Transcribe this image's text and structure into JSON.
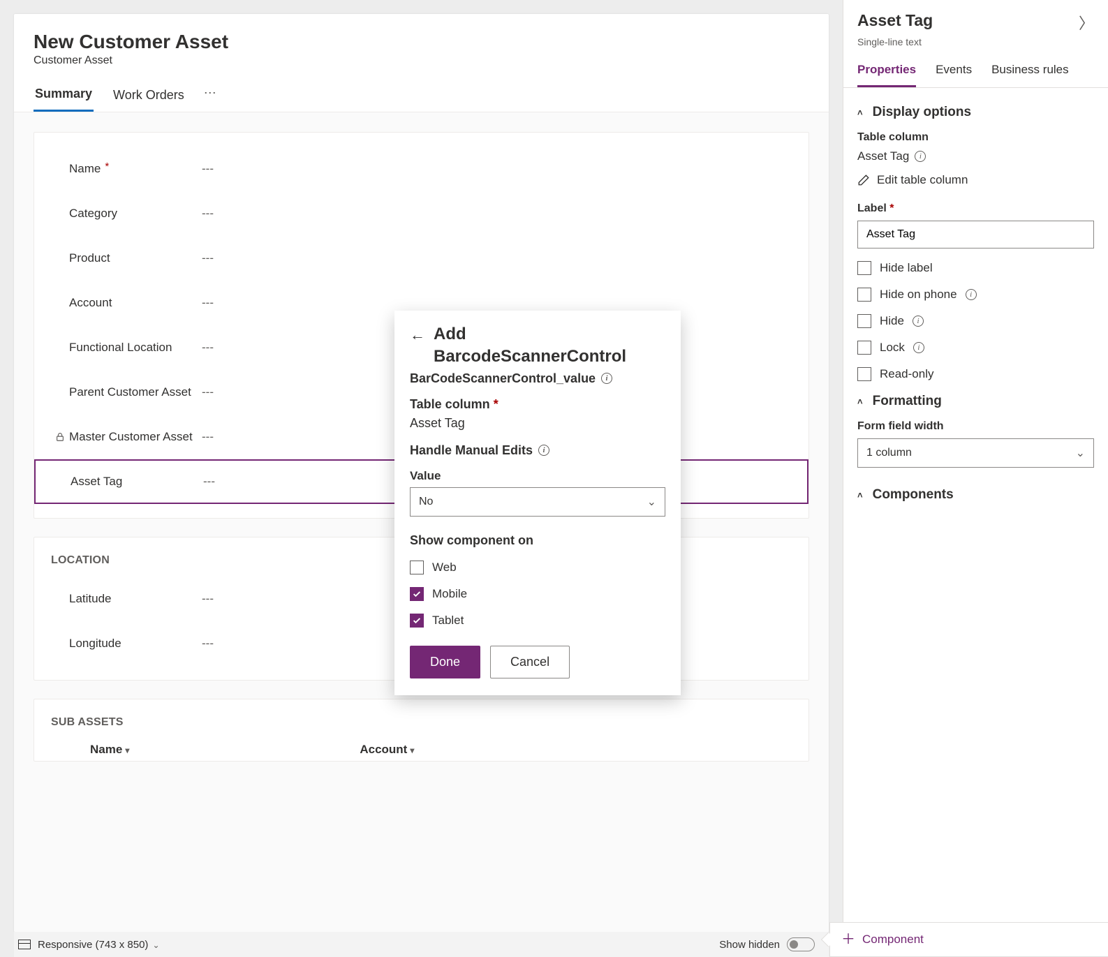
{
  "form": {
    "title": "New Customer Asset",
    "entity": "Customer Asset",
    "tabs": [
      "Summary",
      "Work Orders"
    ],
    "active_tab": "Summary",
    "general_fields": [
      {
        "label": "Name",
        "required": true,
        "locked": false,
        "value": "---"
      },
      {
        "label": "Category",
        "required": false,
        "locked": false,
        "value": "---"
      },
      {
        "label": "Product",
        "required": false,
        "locked": false,
        "value": "---"
      },
      {
        "label": "Account",
        "required": false,
        "locked": false,
        "value": "---"
      },
      {
        "label": "Functional Location",
        "required": false,
        "locked": false,
        "value": "---"
      },
      {
        "label": "Parent Customer Asset",
        "required": false,
        "locked": false,
        "value": "---"
      },
      {
        "label": "Master Customer Asset",
        "required": false,
        "locked": true,
        "value": "---"
      },
      {
        "label": "Asset Tag",
        "required": false,
        "locked": false,
        "value": "---",
        "selected": true
      }
    ],
    "location_section": {
      "title": "LOCATION",
      "fields": [
        {
          "label": "Latitude",
          "value": "---"
        },
        {
          "label": "Longitude",
          "value": "---"
        }
      ]
    },
    "subassets_section": {
      "title": "SUB ASSETS",
      "columns": [
        "Name",
        "Account"
      ]
    }
  },
  "statusbar": {
    "mode_label": "Responsive (743 x 850)",
    "show_hidden_label": "Show hidden"
  },
  "popup": {
    "title_line1": "Add",
    "title_line2": "BarcodeScannerControl",
    "subtitle": "BarCodeScannerControl_value",
    "table_column_label": "Table column",
    "table_column_value": "Asset Tag",
    "manual_edits_label": "Handle Manual Edits",
    "value_label": "Value",
    "value_selected": "No",
    "show_on_label": "Show component on",
    "platforms": [
      {
        "label": "Web",
        "checked": false
      },
      {
        "label": "Mobile",
        "checked": true
      },
      {
        "label": "Tablet",
        "checked": true
      }
    ],
    "done": "Done",
    "cancel": "Cancel"
  },
  "props": {
    "title": "Asset Tag",
    "subtitle": "Single-line text",
    "tabs": [
      "Properties",
      "Events",
      "Business rules"
    ],
    "active_tab": "Properties",
    "display_options_heading": "Display options",
    "table_column_label": "Table column",
    "table_column_value": "Asset Tag",
    "edit_table_column": "Edit table column",
    "label_field_label": "Label",
    "label_field_value": "Asset Tag",
    "checkboxes": [
      {
        "label": "Hide label",
        "info": false
      },
      {
        "label": "Hide on phone",
        "info": true
      },
      {
        "label": "Hide",
        "info": true
      },
      {
        "label": "Lock",
        "info": true
      },
      {
        "label": "Read-only",
        "info": false
      }
    ],
    "formatting_heading": "Formatting",
    "width_label": "Form field width",
    "width_value": "1 column",
    "components_heading": "Components",
    "add_component_label": "Component"
  }
}
